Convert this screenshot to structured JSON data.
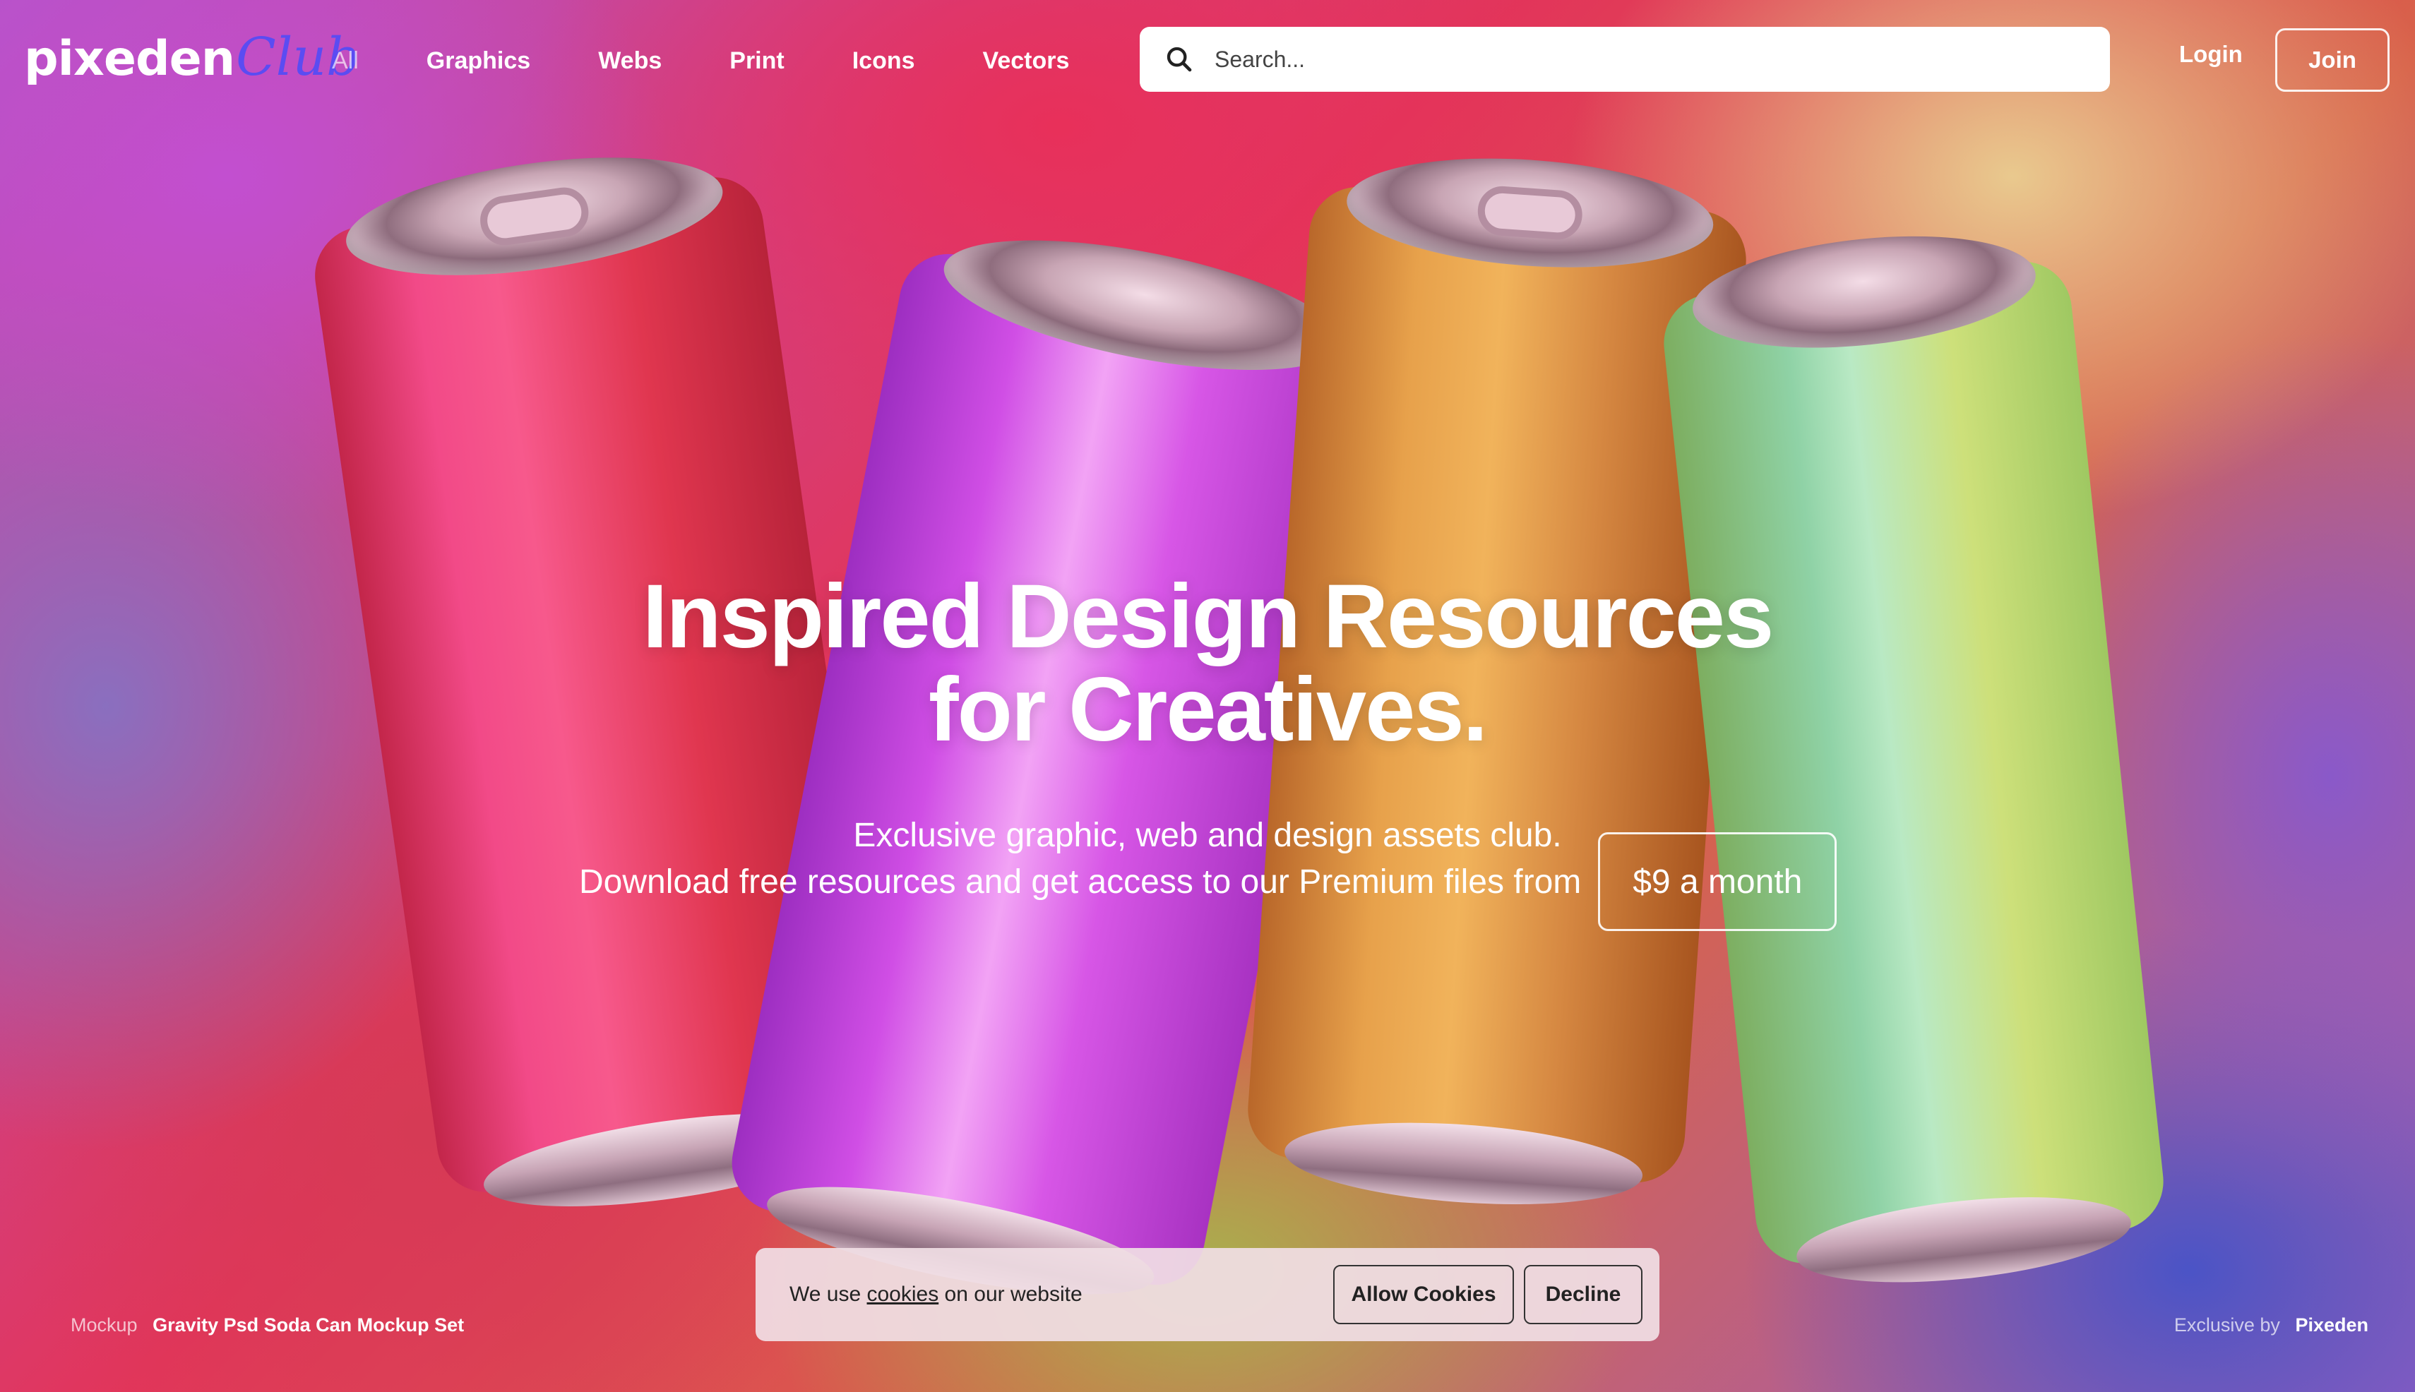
{
  "brand": {
    "name": "pixeden",
    "suffix": "Club",
    "accent": "#5b4cf2"
  },
  "nav": {
    "items": [
      {
        "label": "All"
      },
      {
        "label": "Graphics"
      },
      {
        "label": "Webs"
      },
      {
        "label": "Print"
      },
      {
        "label": "Icons"
      },
      {
        "label": "Vectors"
      }
    ]
  },
  "search": {
    "placeholder": "Search..."
  },
  "account": {
    "login_label": "Login",
    "join_label": "Join"
  },
  "hero": {
    "title_line1": "Inspired Design Resources",
    "title_line2": "for Creatives.",
    "subtitle": "Exclusive graphic, web and design assets club.",
    "line2_text": "Download free resources and get access to our Premium files from",
    "price_label": "$9 a month"
  },
  "credit": {
    "left_label": "Mockup",
    "left_value": "Gravity Psd Soda Can Mockup Set",
    "right_label": "Exclusive by",
    "right_value": "Pixeden"
  },
  "cookies": {
    "text_before": "We use ",
    "link": "cookies",
    "text_after": " on our website",
    "allow_label": "Allow Cookies",
    "decline_label": "Decline"
  }
}
